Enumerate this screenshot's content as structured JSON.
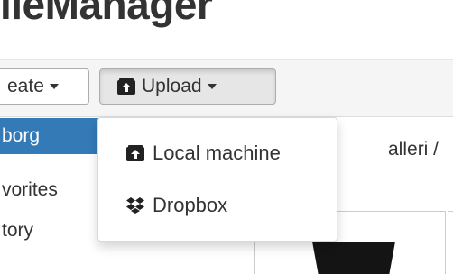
{
  "header": {
    "app_title": "ileManager"
  },
  "toolbar": {
    "create_label": "eate",
    "upload_label": "Upload"
  },
  "upload_menu": {
    "items": [
      {
        "label": "Local machine",
        "icon": "upload-box-icon"
      },
      {
        "label": "Dropbox",
        "icon": "dropbox-icon"
      }
    ]
  },
  "sidebar": {
    "items": [
      {
        "label": "borg",
        "active": true
      },
      {
        "label": "vorites",
        "active": false
      },
      {
        "label": "tory",
        "active": false
      }
    ]
  },
  "main": {
    "breadcrumb_label": "alleri /"
  },
  "colors": {
    "active_bg": "#337ab7",
    "toolbar_bg": "#f5f5f5",
    "button_border": "#adadad"
  }
}
